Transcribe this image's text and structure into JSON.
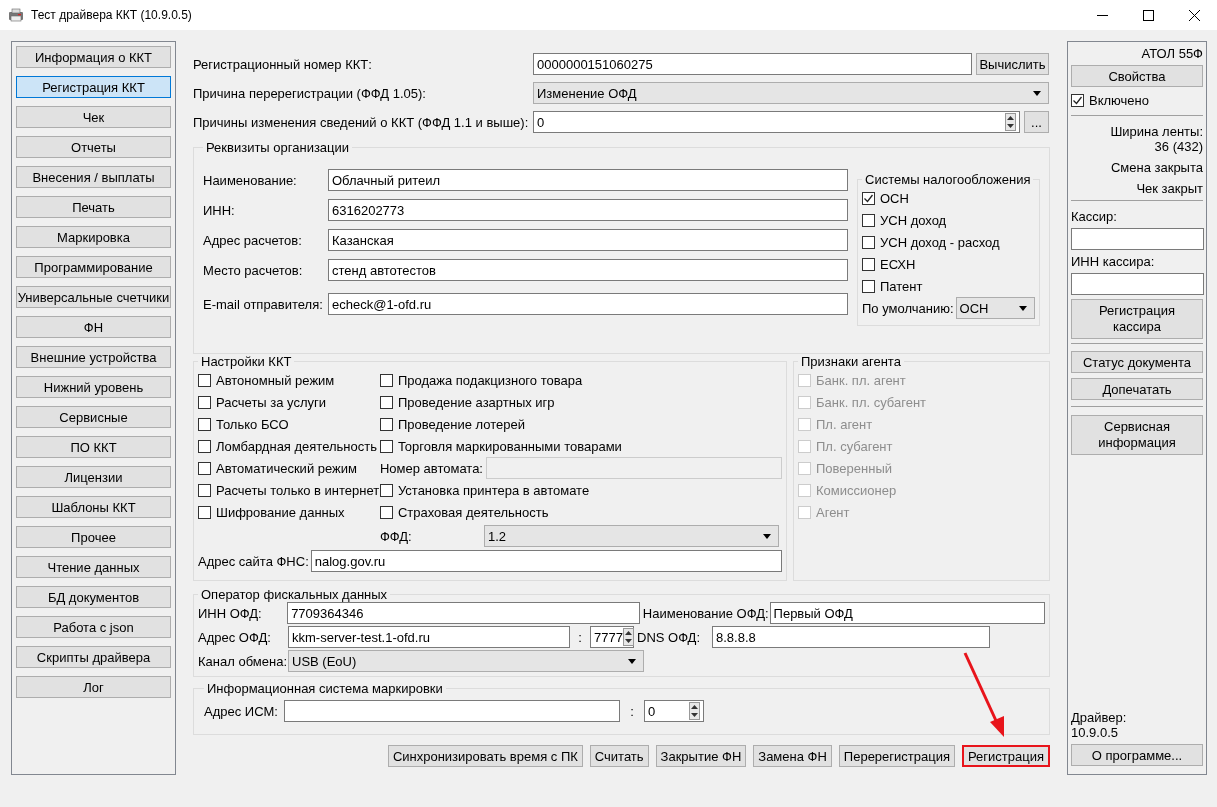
{
  "window": {
    "title": "Тест драйвера ККТ (10.9.0.5)"
  },
  "sidebar": [
    {
      "label": "Информация о ККТ",
      "selected": false
    },
    {
      "label": "Регистрация ККТ",
      "selected": true
    },
    {
      "label": "Чек",
      "selected": false
    },
    {
      "label": "Отчеты",
      "selected": false
    },
    {
      "label": "Внесения / выплаты",
      "selected": false
    },
    {
      "label": "Печать",
      "selected": false
    },
    {
      "label": "Маркировка",
      "selected": false
    },
    {
      "label": "Программирование",
      "selected": false
    },
    {
      "label": "Универсальные счетчики",
      "selected": false
    },
    {
      "label": "ФН",
      "selected": false
    },
    {
      "label": "Внешние устройства",
      "selected": false
    },
    {
      "label": "Нижний уровень",
      "selected": false
    },
    {
      "label": "Сервисные",
      "selected": false
    },
    {
      "label": "ПО ККТ",
      "selected": false
    },
    {
      "label": "Лицензии",
      "selected": false
    },
    {
      "label": "Шаблоны ККТ",
      "selected": false
    },
    {
      "label": "Прочее",
      "selected": false
    },
    {
      "label": "Чтение данных",
      "selected": false
    },
    {
      "label": "БД документов",
      "selected": false
    },
    {
      "label": "Работа с json",
      "selected": false
    },
    {
      "label": "Скрипты драйвера",
      "selected": false
    },
    {
      "label": "Лог",
      "selected": false
    }
  ],
  "registration": {
    "reg_number": {
      "label": "Регистрационный номер ККТ:",
      "value": "0000000151060275",
      "button": "Вычислить"
    },
    "reason": {
      "label": "Причина перерегистрации (ФФД 1.05):",
      "value": "Изменение ОФД"
    },
    "change_reasons": {
      "label": "Причины изменения сведений о ККТ (ФФД 1.1 и выше):",
      "value": "0",
      "button": "..."
    }
  },
  "organization": {
    "title": "Реквизиты организации",
    "fields": [
      {
        "label": "Наименование:",
        "value": "Облачный ритеил"
      },
      {
        "label": "ИНН:",
        "value": "6316202773"
      },
      {
        "label": "Адрес расчетов:",
        "value": "Казанская"
      },
      {
        "label": "Место расчетов:",
        "value": "стенд автотестов"
      },
      {
        "label": "E-mail отправителя:",
        "value": "echeck@1-ofd.ru"
      }
    ],
    "tax": {
      "title": "Системы налогообложения",
      "options": [
        {
          "label": "ОСН",
          "checked": true
        },
        {
          "label": "УСН доход",
          "checked": false
        },
        {
          "label": "УСН доход - расход",
          "checked": false
        },
        {
          "label": "ЕСХН",
          "checked": false
        },
        {
          "label": "Патент",
          "checked": false
        }
      ],
      "default_label": "По умолчанию:",
      "default_value": "ОСН"
    }
  },
  "settings": {
    "title": "Настройки ККТ",
    "left": [
      {
        "label": "Автономный режим",
        "checked": false
      },
      {
        "label": "Расчеты за услуги",
        "checked": false
      },
      {
        "label": "Только БСО",
        "checked": false
      },
      {
        "label": "Ломбардная деятельность",
        "checked": false
      },
      {
        "label": "Автоматический режим",
        "checked": false
      },
      {
        "label": "Расчеты только в интернет",
        "checked": false
      },
      {
        "label": "Шифрование данных",
        "checked": false
      }
    ],
    "right": [
      {
        "kind": "checkbox",
        "label": "Продажа подакцизного товара",
        "checked": false
      },
      {
        "kind": "checkbox",
        "label": "Проведение азартных игр",
        "checked": false
      },
      {
        "kind": "checkbox",
        "label": "Проведение лотерей",
        "checked": false
      },
      {
        "kind": "checkbox",
        "label": "Торговля маркированными товарами",
        "checked": false
      },
      {
        "kind": "field",
        "label": "Номер автомата:",
        "disabled": true
      },
      {
        "kind": "checkbox",
        "label": "Установка принтера в автомате",
        "checked": false
      },
      {
        "kind": "checkbox",
        "label": "Страховая деятельность",
        "checked": false
      },
      {
        "kind": "select",
        "label": "ФФД:",
        "value": "1.2"
      }
    ],
    "fns_site": {
      "label": "Адрес сайта ФНС:",
      "value": "nalog.gov.ru"
    }
  },
  "agent": {
    "title": "Признаки агента",
    "options": [
      {
        "label": "Банк. пл. агент",
        "checked": false,
        "disabled": true
      },
      {
        "label": "Банк. пл. субагент",
        "checked": false,
        "disabled": true
      },
      {
        "label": "Пл. агент",
        "checked": false,
        "disabled": true
      },
      {
        "label": "Пл. субагент",
        "checked": false,
        "disabled": true
      },
      {
        "label": "Поверенный",
        "checked": false,
        "disabled": true
      },
      {
        "label": "Комиссионер",
        "checked": false,
        "disabled": true
      },
      {
        "label": "Агент",
        "checked": false,
        "disabled": true
      }
    ]
  },
  "ofd": {
    "title": "Оператор фискальных данных",
    "inn": {
      "label": "ИНН ОФД:",
      "value": "7709364346"
    },
    "name": {
      "label": "Наименование ОФД:",
      "value": "Первый ОФД"
    },
    "address": {
      "label": "Адрес ОФД:",
      "value": "kkm-server-test.1-ofd.ru",
      "separator": ":",
      "port": "7777"
    },
    "dns": {
      "label": "DNS ОФД:",
      "value": "8.8.8.8"
    },
    "channel": {
      "label": "Канал обмена:",
      "value": "USB (EoU)"
    }
  },
  "ism": {
    "title": "Информационная система маркировки",
    "label": "Адрес ИСМ:",
    "separator": ":",
    "port": "0"
  },
  "buttons": [
    {
      "label": "Синхронизировать время с ПК",
      "highlighted": false
    },
    {
      "label": "Считать",
      "highlighted": false
    },
    {
      "label": "Закрытие ФН",
      "highlighted": false
    },
    {
      "label": "Замена ФН",
      "highlighted": false
    },
    {
      "label": "Перерегистрация",
      "highlighted": false
    },
    {
      "label": "Регистрация",
      "highlighted": true
    }
  ],
  "device": {
    "model": "АТОЛ 55Ф",
    "properties_button": "Свойства",
    "enabled": {
      "label": "Включено",
      "checked": true
    },
    "tape_label": "Ширина ленты:",
    "tape_value": "36 (432)",
    "shift_status": "Смена закрыта",
    "receipt_status": "Чек закрыт",
    "cashier_label": "Кассир:",
    "cashier_inn_label": "ИНН кассира:",
    "cashier_button": "Регистрация кассира",
    "status_button": "Статус документа",
    "reprint_button": "Допечатать",
    "service_button": "Сервисная информация",
    "driver_label": "Драйвер:",
    "driver_version": "10.9.0.5",
    "about_button": "О программе..."
  }
}
